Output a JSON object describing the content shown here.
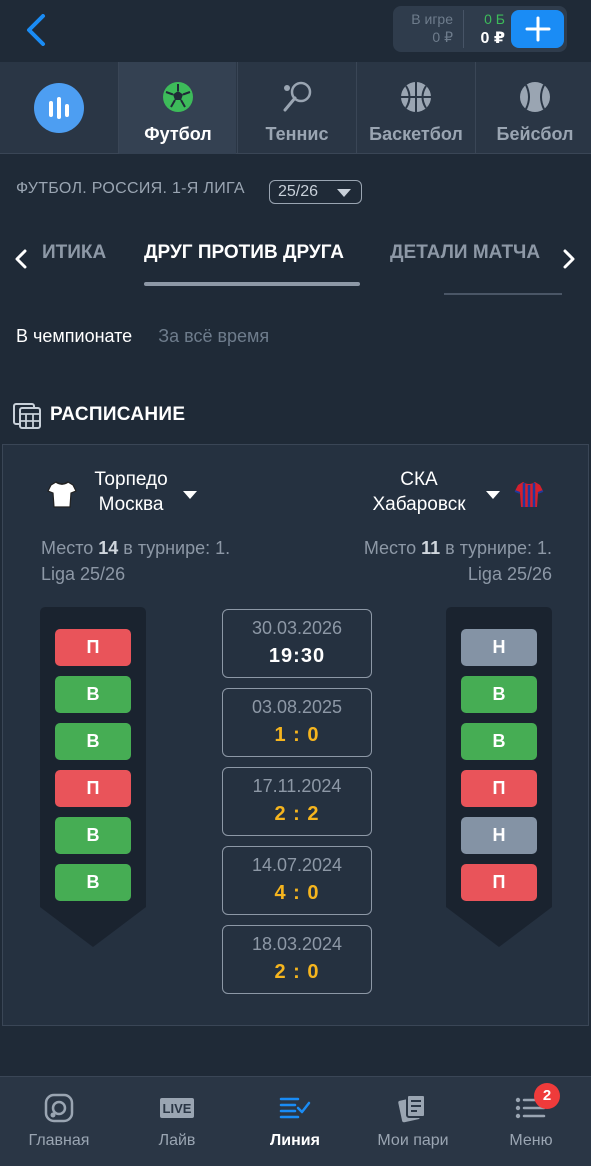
{
  "header": {
    "back": "back-arrow-icon",
    "balance": {
      "in_game_label": "В игре",
      "in_game_value": "0 ₽",
      "bonus": "0 Б",
      "main": "0 ₽"
    },
    "add": "plus-icon"
  },
  "sports": [
    {
      "label": "Футбол",
      "icon": "soccer-ball-icon",
      "active": true
    },
    {
      "label": "Теннис",
      "icon": "tennis-racket-icon",
      "active": false
    },
    {
      "label": "Баскетбол",
      "icon": "basketball-icon",
      "active": false
    },
    {
      "label": "Бейсбол",
      "icon": "baseball-icon",
      "active": false
    }
  ],
  "league": {
    "name": "ФУТБОЛ. РОССИЯ. 1-Я ЛИГА",
    "season": "25/26"
  },
  "subtabs": {
    "left": "ИТИКА",
    "active": "ДРУГ ПРОТИВ ДРУГА",
    "right": "ДЕТАЛИ МАТЧА"
  },
  "period": {
    "selected": "В чемпионате",
    "other": "За всё время"
  },
  "section": {
    "title": "РАСПИСАНИЕ"
  },
  "teams": {
    "home": {
      "name_line1": "Торпедо",
      "name_line2": "Москва",
      "place_line1_prefix": "Место ",
      "place_number": "14",
      "place_line1_suffix": " в турнире: 1.",
      "place_line2": "Liga 25/26",
      "form": [
        "П",
        "В",
        "В",
        "П",
        "В",
        "В"
      ],
      "form_types": [
        "l",
        "w",
        "w",
        "l",
        "w",
        "w"
      ]
    },
    "away": {
      "name_line1": "СКА",
      "name_line2": "Хабаровск",
      "place_line1_prefix": "Место ",
      "place_number": "11",
      "place_line1_suffix": " в турнире: 1.",
      "place_line2": "Liga 25/26",
      "form": [
        "Н",
        "В",
        "В",
        "П",
        "Н",
        "П"
      ],
      "form_types": [
        "d",
        "w",
        "w",
        "l",
        "d",
        "l"
      ]
    }
  },
  "matches": [
    {
      "date": "30.03.2026",
      "score": "19:30",
      "upcoming": true
    },
    {
      "date": "03.08.2025",
      "score": "1 : 0",
      "upcoming": false
    },
    {
      "date": "17.11.2024",
      "score": "2 : 2",
      "upcoming": false
    },
    {
      "date": "14.07.2024",
      "score": "4 : 0",
      "upcoming": false
    },
    {
      "date": "18.03.2024",
      "score": "2 : 0",
      "upcoming": false
    }
  ],
  "nav": [
    {
      "label": "Главная",
      "icon": "home-icon"
    },
    {
      "label": "Лайв",
      "icon": "live-icon",
      "icon_text": "LIVE"
    },
    {
      "label": "Линия",
      "icon": "line-list-icon",
      "active": true
    },
    {
      "label": "Мои пари",
      "icon": "bets-icon"
    },
    {
      "label": "Меню",
      "icon": "menu-icon",
      "badge": "2"
    }
  ],
  "colors": {
    "background": "#1f2a37",
    "accent": "#1a8cf5",
    "win": "#46ad54",
    "loss": "#e9545a",
    "draw": "#8493a5",
    "score": "#f6b51e"
  }
}
